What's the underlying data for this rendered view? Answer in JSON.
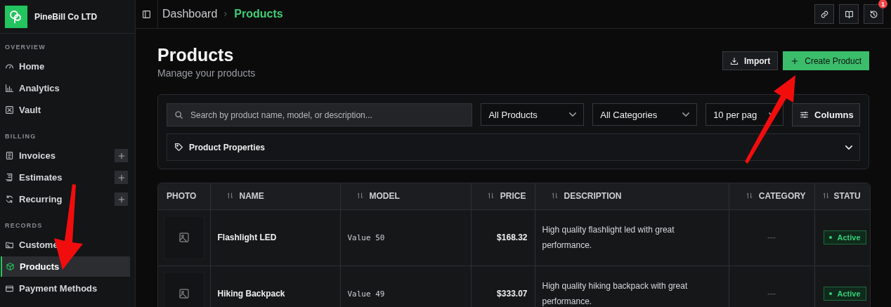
{
  "sidebar": {
    "company": "PineBill Co LTD",
    "sections": [
      {
        "label": "OVERVIEW",
        "items": [
          {
            "label": "Home",
            "selected": false,
            "has_add": false
          },
          {
            "label": "Analytics",
            "selected": false,
            "has_add": false
          },
          {
            "label": "Vault",
            "selected": false,
            "has_add": false
          }
        ]
      },
      {
        "label": "BILLING",
        "items": [
          {
            "label": "Invoices",
            "selected": false,
            "has_add": true
          },
          {
            "label": "Estimates",
            "selected": false,
            "has_add": true
          },
          {
            "label": "Recurring",
            "selected": false,
            "has_add": true
          }
        ]
      },
      {
        "label": "RECORDS",
        "items": [
          {
            "label": "Custome",
            "selected": false,
            "has_add": false
          },
          {
            "label": "Products",
            "selected": true,
            "has_add": false
          },
          {
            "label": "Payment Methods",
            "selected": false,
            "has_add": false
          }
        ]
      }
    ]
  },
  "topbar": {
    "breadcrumb": [
      {
        "label": "Dashboard",
        "selected": false
      },
      {
        "label": "Products",
        "selected": true
      }
    ],
    "history_badge": "1"
  },
  "header": {
    "title": "Products",
    "subtitle": "Manage your products",
    "buttons": [
      {
        "label": "Import",
        "kind": "import"
      },
      {
        "label": "Create Product",
        "kind": "create"
      }
    ]
  },
  "filters": {
    "search": {
      "placeholder": "Search by product name, model, or description..."
    },
    "selects": [
      "All Products",
      "All Categories",
      "10 per pag"
    ],
    "columns_button": "Columns",
    "properties": "Product Properties"
  },
  "table": {
    "columns": [
      "PHOTO",
      "NAME",
      "MODEL",
      "PRICE",
      "DESCRIPTION",
      "CATEGORY",
      "STATU"
    ],
    "rows": [
      {
        "name": "Flashlight LED",
        "model": "Value 50",
        "price": "$168.32",
        "description": "High quality flashlight led with great performance.",
        "category": "---",
        "status": "Active"
      },
      {
        "name": "Hiking Backpack",
        "model": "Value 49",
        "price": "$333.07",
        "description": "High quality hiking backpack with great performance.",
        "category": "---",
        "status": "Active"
      }
    ]
  },
  "annotations": [
    {
      "kind": "arrow"
    },
    {
      "kind": "arrow"
    }
  ]
}
